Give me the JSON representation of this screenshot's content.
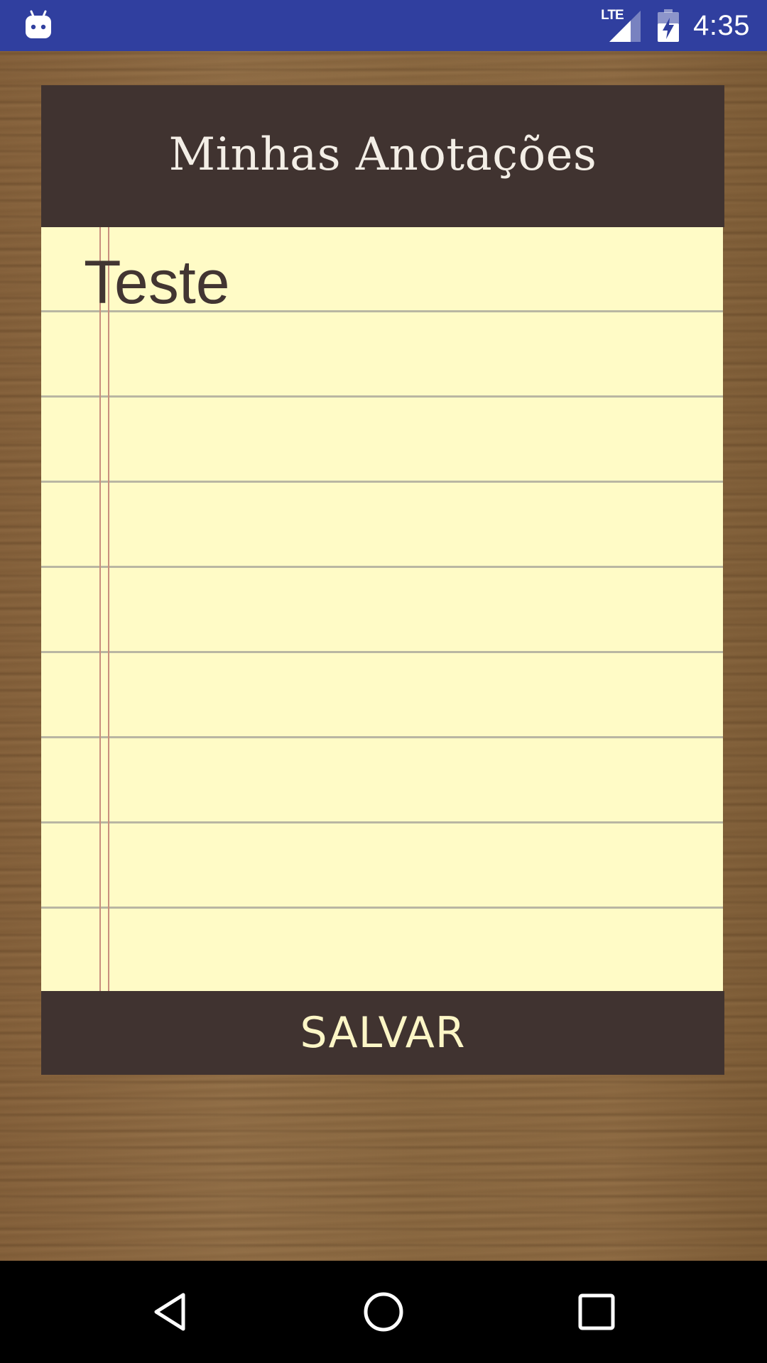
{
  "status_bar": {
    "network_label": "LTE",
    "time": "4:35",
    "notification_icon": "android-icon",
    "color": "#303f9f"
  },
  "header": {
    "title": "Minhas Anotações"
  },
  "note": {
    "text": "Teste"
  },
  "actions": {
    "save_label": "SALVAR"
  },
  "nav_bar": {
    "back_icon": "back-triangle-icon",
    "home_icon": "home-circle-icon",
    "recents_icon": "recents-square-icon"
  },
  "colors": {
    "header_bg": "#403330",
    "paper": "#fffbc6",
    "save_text": "#fcf6c6",
    "note_text": "#423532",
    "wood": "#8b6840"
  }
}
